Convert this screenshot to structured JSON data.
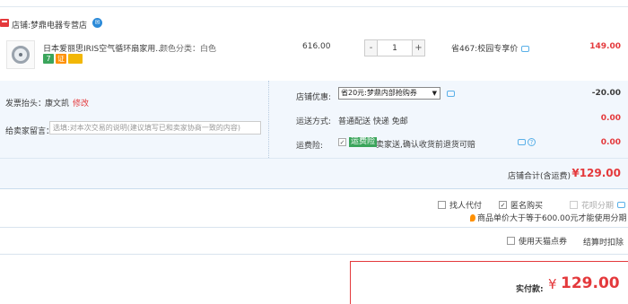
{
  "shop": {
    "label": "店铺:",
    "name": "梦鼎电器专营店"
  },
  "item": {
    "title": "日本爱丽思IRIS空气循环扇家用...",
    "spec": "颜色分类：白色",
    "service_badges": [
      "7",
      "证"
    ],
    "unit_price": "616.00",
    "quantity": "1",
    "qty_minus": "-",
    "qty_plus": "+",
    "discount": "省467:校园专享价",
    "price": "149.00"
  },
  "invoice": {
    "label": "发票抬头：",
    "value": "康文凯",
    "edit": "修改"
  },
  "message": {
    "label": "给卖家留言：",
    "placeholder": "选填:对本次交易的说明(建议填写已和卖家协商一致的内容)"
  },
  "shop_discount": {
    "label": "店铺优惠:",
    "selected": "省20元:梦鼎内部抢购券",
    "amount": "-20.00"
  },
  "shipping": {
    "label": "运送方式:",
    "value": "普通配送 快递 免邮",
    "amount": "0.00"
  },
  "insurance": {
    "label": "运费险:",
    "tag": "运费险",
    "text": "卖家送,确认收货前退货可赔",
    "amount": "0.00"
  },
  "subtotal": {
    "label": "店铺合计(含运费)",
    "value": "¥129.00"
  },
  "checkout_options": {
    "friend_pay": "找人代付",
    "anonymous": "匿名购买",
    "huabei": "花呗分期",
    "note": "商品单价大于等于600.00元才能使用分期",
    "tmall_coupon": "使用天猫点券",
    "settle_points": "结算时扣除"
  },
  "payment": {
    "label": "实付款:",
    "symbol": "¥",
    "value": "129.00"
  },
  "colors": {
    "accent": "#e4393c",
    "panel": "#f2f7fd",
    "link": "#5ab0e8",
    "badge_green": "#3ba55c",
    "badge_orange": "#ff9000"
  }
}
